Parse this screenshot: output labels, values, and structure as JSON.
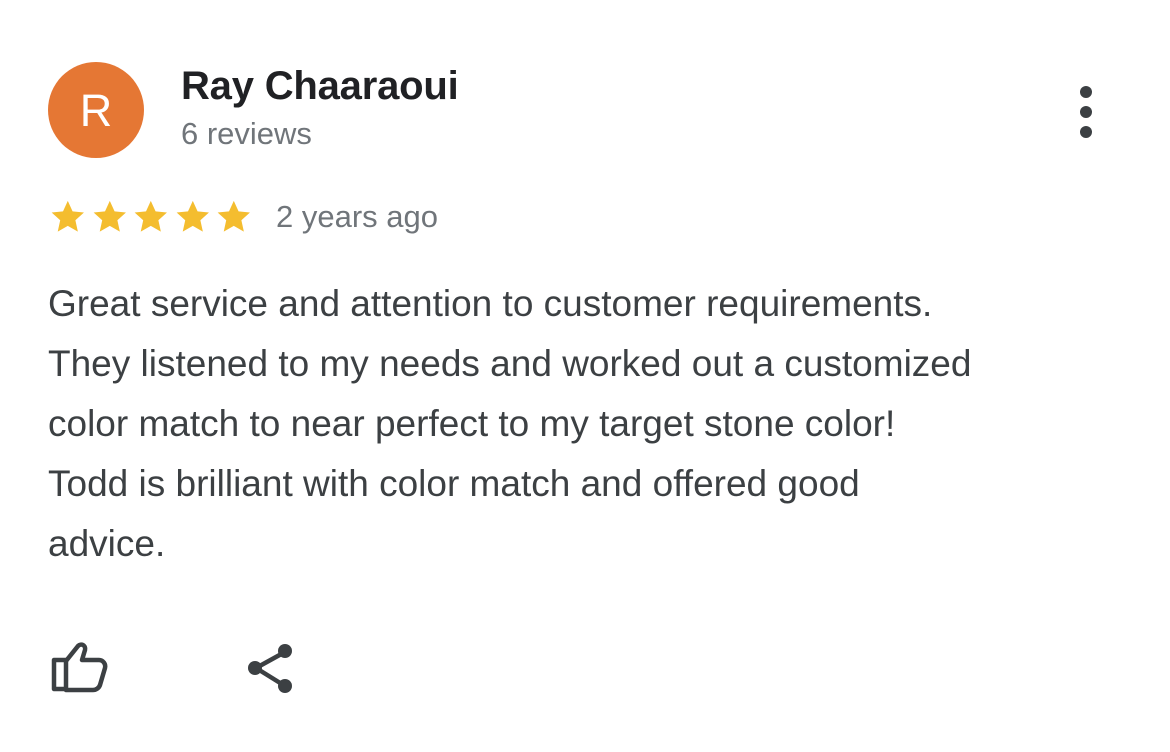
{
  "review": {
    "reviewer": {
      "avatar_letter": "R",
      "avatar_color": "#e57734",
      "name": "Ray Chaaraoui",
      "review_count": "6 reviews"
    },
    "menu_icon": "more-vert-icon",
    "rating": {
      "stars": 5,
      "max_stars": 5,
      "star_color": "#f4bd2f",
      "date": "2 years ago"
    },
    "text_lines": [
      "Great service and attention to customer requirements.",
      "They listened to my needs and worked out a customized",
      "color match to near perfect to my target stone color!",
      "Todd is brilliant with color match and offered good",
      "advice."
    ],
    "actions": {
      "like_icon": "thumb-up-icon",
      "share_icon": "share-icon"
    }
  },
  "colors": {
    "text_primary": "#202124",
    "text_body": "#3c4043",
    "text_secondary": "#70757a",
    "icon": "#3c4043"
  }
}
